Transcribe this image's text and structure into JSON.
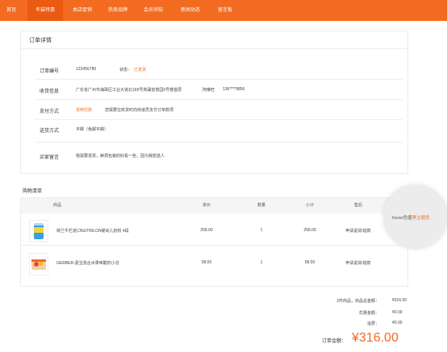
{
  "nav": {
    "items": [
      {
        "label": "首页"
      },
      {
        "label": "冬装特惠"
      },
      {
        "label": "本店促销"
      },
      {
        "label": "热卖品牌"
      },
      {
        "label": "会员须知"
      },
      {
        "label": "新闻动态"
      },
      {
        "label": "留言板"
      }
    ],
    "active_index": 1
  },
  "detail": {
    "title": "订单详情",
    "order_no_label": "订单编号",
    "order_no": "123456789",
    "status_label": "状态：",
    "status_value": "已发货",
    "address_label": "收货信息",
    "address_value": "广东省广州市海珠区工业大道北165号岚晟创意园5号楼首层",
    "recipient": "阿琳旺",
    "phone": "136****9856",
    "payment_label": "支付方式",
    "payment_value": "货到付款",
    "payment_note": "您需要在收货时向快递员支付订单款项",
    "delivery_label": "送货方式",
    "delivery_value": "平邮（免邮平邮）",
    "message_label": "买家留言",
    "message_value": "我需要发票，麻烦包装的好看一些，因为我想送人"
  },
  "cart": {
    "title": "购物清单",
    "headers": [
      "商品",
      "单价",
      "数量",
      "小计",
      "售后"
    ],
    "rows": [
      {
        "product": "荷兰牛栏进口NUTRILON婴幼儿奶粉 4段",
        "price": "258.00",
        "qty": "1",
        "subtotal": "258.00",
        "after_sale": "申请退货/退款",
        "after_sale_color": "#f36b21"
      },
      {
        "product": "GERBER-嘉宝混合水果味酸奶小溶",
        "price": "58.00",
        "qty": "1",
        "subtotal": "58.00",
        "after_sale": "申请退货/退款",
        "after_sale_color": "#444444"
      }
    ]
  },
  "hover_hint": {
    "prefix": "hover色值",
    "highlight": "黑主题色"
  },
  "summary": {
    "items_label": "2件商品，商品总金额：",
    "items_value": "¥316.00",
    "discount_label": "优惠金额：",
    "discount_value": "¥0.00",
    "shipping_label": "运费：",
    "shipping_value": "¥0.00",
    "total_label": "订单金额：",
    "total_value": "¥316.00"
  },
  "colors": {
    "brand": "#f36b21",
    "nav_active": "#ea5a10"
  },
  "icons": {
    "product_1": "milk-powder-can-image",
    "product_2": "yogurt-melts-pack-image"
  }
}
